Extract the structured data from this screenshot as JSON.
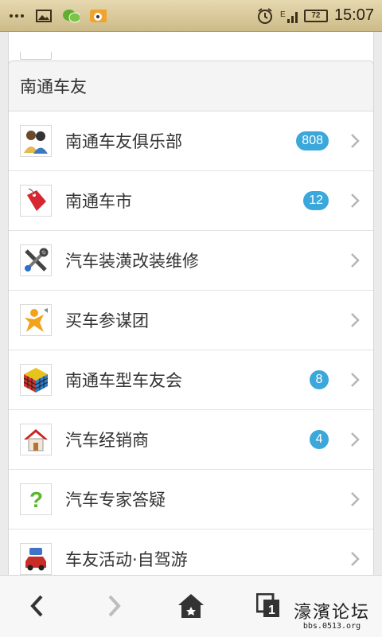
{
  "status_bar": {
    "left_icons": [
      "more-icon",
      "gallery-icon",
      "wechat-icon",
      "weibo-icon"
    ],
    "right_icons": [
      "alarm-icon",
      "signal-icon"
    ],
    "battery": "72",
    "time": "15:07"
  },
  "section": {
    "title": "南通车友",
    "items": [
      {
        "label": "南通车友俱乐部",
        "badge": "808",
        "icon": "people-icon"
      },
      {
        "label": "南通车市",
        "badge": "12",
        "icon": "sale-tag-icon"
      },
      {
        "label": "汽车装潢改装维修",
        "badge": "",
        "icon": "tools-icon"
      },
      {
        "label": "买车参谋团",
        "badge": "",
        "icon": "person-megaphone-icon"
      },
      {
        "label": "南通车型车友会",
        "badge": "8",
        "icon": "rubiks-cube-icon"
      },
      {
        "label": "汽车经销商",
        "badge": "4",
        "icon": "house-icon"
      },
      {
        "label": "汽车专家答疑",
        "badge": "",
        "icon": "question-icon"
      },
      {
        "label": "车友活动·自驾游",
        "badge": "",
        "icon": "car-luggage-icon"
      }
    ]
  },
  "bottom_nav": {
    "back": "back-icon",
    "forward": "forward-icon",
    "home": "home-icon",
    "tabs_count": "1",
    "watermark_title": "濠濱论坛",
    "watermark_url": "bbs.0513.org"
  },
  "colors": {
    "badge": "#3ba7db",
    "status_bar": "#d9c89a"
  }
}
